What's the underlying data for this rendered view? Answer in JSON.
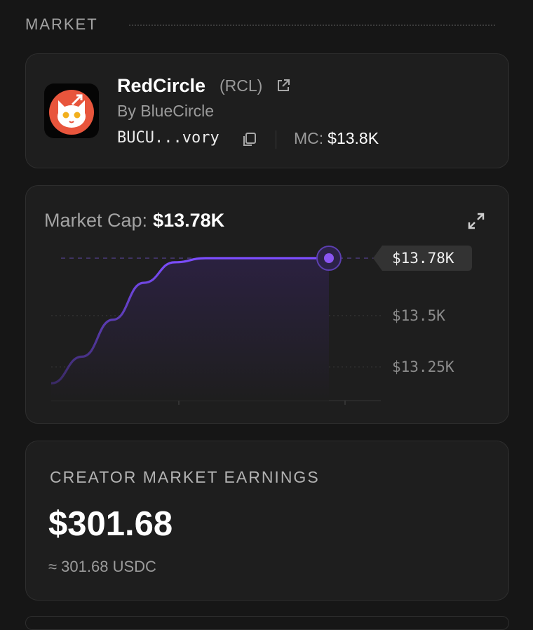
{
  "section": {
    "title": "MARKET"
  },
  "token": {
    "name": "RedCircle",
    "ticker": "(RCL)",
    "creator": "By BlueCircle",
    "address": "BUCU...vory",
    "mc_label": "MC:",
    "mc_value": "$13.8K",
    "icons": {
      "external": "external-link-icon",
      "copy": "copy-icon",
      "logo": "cat-logo"
    }
  },
  "chart": {
    "label": "Market Cap:",
    "value": "$13.78K",
    "expand_icon": "expand-icon"
  },
  "chart_data": {
    "type": "area",
    "y_ticks": [
      "$13.78K",
      "$13.5K",
      "$13.25K"
    ],
    "y_tick_values": [
      13780,
      13500,
      13250
    ],
    "current_label": "$13.78K",
    "current_value": 13780,
    "series": [
      {
        "values": [
          13170,
          13300,
          13480,
          13660,
          13760,
          13780,
          13780,
          13780,
          13780,
          13780
        ]
      }
    ],
    "colors": {
      "line": "#7c4dff",
      "fill": "#241d33",
      "marker": "#8a55f0"
    },
    "grid": true
  },
  "earnings": {
    "title": "CREATOR MARKET EARNINGS",
    "value": "$301.68",
    "sub": "≈ 301.68 USDC"
  }
}
